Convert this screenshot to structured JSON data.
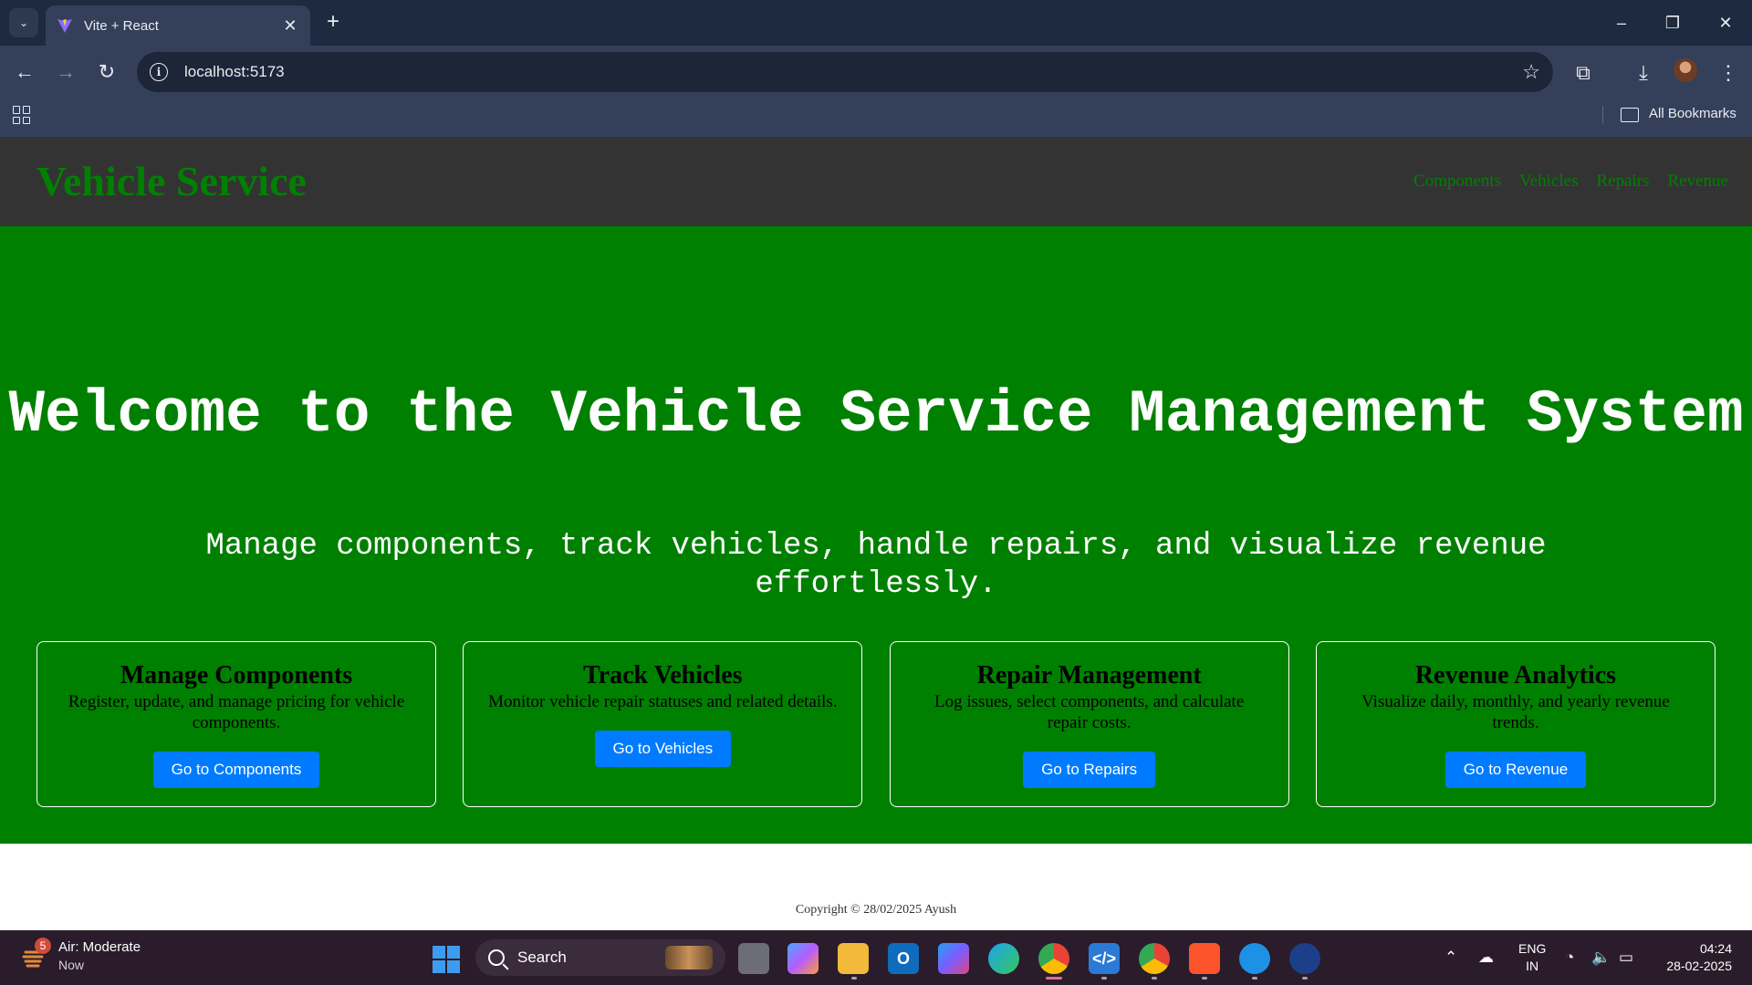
{
  "browser": {
    "tab_title": "Vite + React",
    "url": "localhost:5173",
    "bookmarks_label": "All Bookmarks",
    "new_tab_glyph": "+",
    "tab_close_glyph": "✕"
  },
  "site": {
    "brand": "Vehicle Service",
    "brand_color": "#008000",
    "nav": [
      {
        "label": "Components"
      },
      {
        "label": "Vehicles"
      },
      {
        "label": "Repairs"
      },
      {
        "label": "Revenue"
      }
    ],
    "hero": {
      "title": "Welcome to the Vehicle Service Management System",
      "subtitle": "Manage components, track vehicles, handle repairs, and visualize revenue effortlessly.",
      "background": "#008000"
    },
    "cards": [
      {
        "title": "Manage Components",
        "description": "Register, update, and manage pricing for vehicle components.",
        "button": "Go to Components"
      },
      {
        "title": "Track Vehicles",
        "description": "Monitor vehicle repair statuses and related details.",
        "button": "Go to Vehicles"
      },
      {
        "title": "Repair Management",
        "description": "Log issues, select components, and calculate repair costs.",
        "button": "Go to Repairs"
      },
      {
        "title": "Revenue Analytics",
        "description": "Visualize daily, monthly, and yearly revenue trends.",
        "button": "Go to Revenue"
      }
    ],
    "button_color": "#007bff",
    "footer": "Copyright © 28/02/2025 Ayush"
  },
  "taskbar": {
    "weather_title": "Air: Moderate",
    "weather_sub": "Now",
    "weather_badge": "5",
    "search_label": "Search",
    "lang_line1": "ENG",
    "lang_line2": "IN",
    "time": "04:24",
    "date": "28-02-2025",
    "apps": [
      "task-view",
      "copilot",
      "file-explorer",
      "outlook",
      "m365",
      "edge",
      "chrome",
      "vscode",
      "chrome-profile",
      "brave",
      "docker",
      "penguin-app"
    ]
  }
}
